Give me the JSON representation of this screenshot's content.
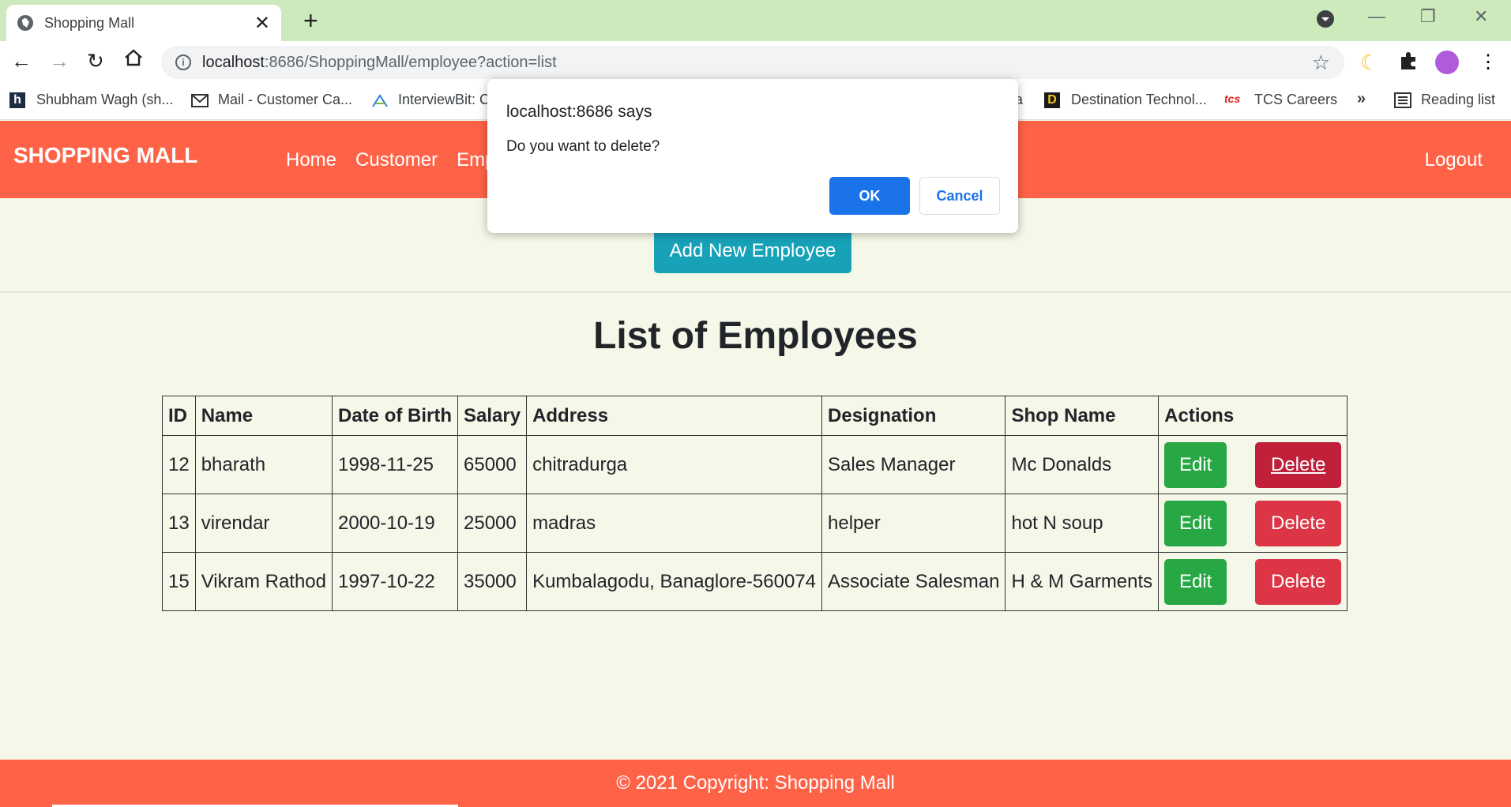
{
  "browser": {
    "tab_title": "Shopping Mall",
    "url_host": "localhost",
    "url_path": ":8686/ShoppingMall/employee?action=list",
    "bookmarks": [
      {
        "label": "Shubham Wagh (sh...",
        "icon": "h-icon"
      },
      {
        "label": "Mail - Customer Ca...",
        "icon": "mail-icon"
      },
      {
        "label": "InterviewBit: C",
        "icon": "interviewbit-icon"
      },
      {
        "label": "a",
        "icon": ""
      },
      {
        "label": "Destination Technol...",
        "icon": "d-icon"
      },
      {
        "label": "TCS Careers",
        "icon": "tcs-icon"
      }
    ],
    "bookmarks_more": "»",
    "reading_list": "Reading list"
  },
  "navbar": {
    "brand": "SHOPPING MALL",
    "links": [
      "Home",
      "Customer",
      "Emp"
    ],
    "logout": "Logout"
  },
  "main": {
    "add_button": "Add New Employee",
    "heading": "List of Employees",
    "columns": [
      "ID",
      "Name",
      "Date of Birth",
      "Salary",
      "Address",
      "Designation",
      "Shop Name",
      "Actions"
    ],
    "rows": [
      {
        "id": "12",
        "name": "bharath",
        "dob": "1998-11-25",
        "salary": "65000",
        "address": "chitradurga",
        "designation": "Sales Manager",
        "shop": "Mc Donalds"
      },
      {
        "id": "13",
        "name": "virendar",
        "dob": "2000-10-19",
        "salary": "25000",
        "address": "madras",
        "designation": "helper",
        "shop": "hot N soup"
      },
      {
        "id": "15",
        "name": "Vikram Rathod",
        "dob": "1997-10-22",
        "salary": "35000",
        "address": "Kumbalagodu, Banaglore-560074",
        "designation": "Associate Salesman",
        "shop": "H & M Garments"
      }
    ],
    "edit_label": "Edit",
    "delete_label": "Delete"
  },
  "footer": {
    "text": "© 2021 Copyright: Shopping Mall"
  },
  "dialog": {
    "title": "localhost:8686 says",
    "message": "Do you want to delete?",
    "ok": "OK",
    "cancel": "Cancel"
  },
  "colors": {
    "navbar": "#ff6347",
    "page_bg": "#f5f7e8",
    "add_button": "#17a2b8",
    "edit": "#28a745",
    "delete": "#dc3545",
    "dialog_ok": "#1a73e8"
  }
}
